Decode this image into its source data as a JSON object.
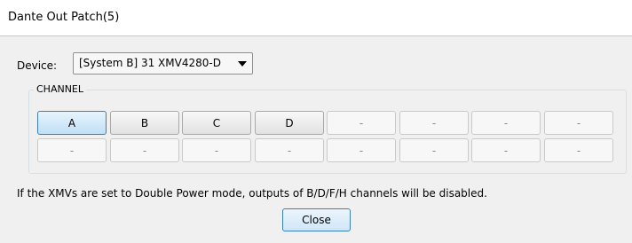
{
  "window": {
    "title": "Dante Out Patch(5)"
  },
  "device": {
    "label": "Device:",
    "selected": "[System B] 31 XMV4280-D"
  },
  "channel_group": {
    "label": "CHANNEL",
    "rows": [
      [
        "A",
        "B",
        "C",
        "D",
        "-",
        "-",
        "-",
        "-"
      ],
      [
        "-",
        "-",
        "-",
        "-",
        "-",
        "-",
        "-",
        "-"
      ]
    ],
    "selected": "A"
  },
  "note": "If the XMVs are set to Double Power mode, outputs of  B/D/F/H channels will be disabled.",
  "buttons": {
    "close": "Close"
  }
}
